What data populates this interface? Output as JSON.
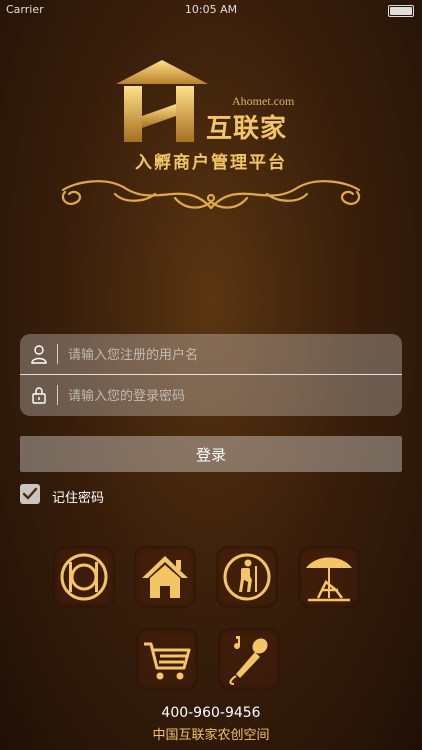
{
  "status_bar": {
    "carrier": "Carrier",
    "time": "10:05 AM"
  },
  "brand": {
    "domain": "Ahomet.com",
    "name": "互联家",
    "slogan": "入孵商户管理平台"
  },
  "login": {
    "username_placeholder": "请输入您注册的用户名",
    "password_placeholder": "请输入您的登录密码",
    "submit_label": "登录",
    "remember_label": "记住密码",
    "remember_checked": true
  },
  "categories": [
    {
      "icon": "restaurant-icon"
    },
    {
      "icon": "home-icon"
    },
    {
      "icon": "hiking-icon"
    },
    {
      "icon": "beach-icon"
    },
    {
      "icon": "shopping-cart-icon"
    },
    {
      "icon": "karaoke-icon"
    }
  ],
  "footer": {
    "phone": "400-960-9456",
    "org": "中国互联家农创空间"
  },
  "colors": {
    "gold": "#f3c565",
    "background": "#3b200b"
  }
}
